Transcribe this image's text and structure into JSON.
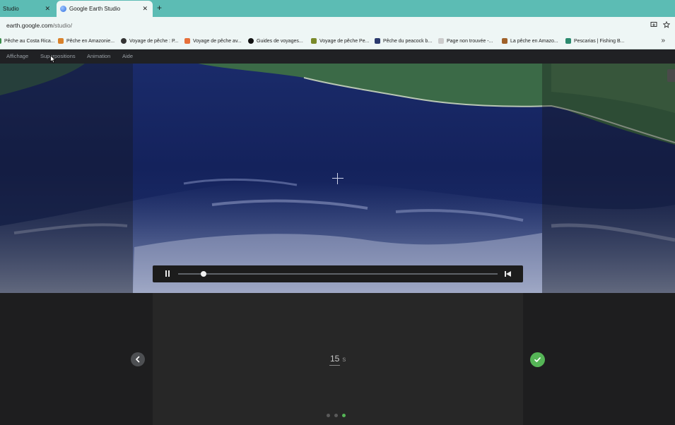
{
  "browser": {
    "tabs": [
      {
        "label": "Studio",
        "active": false
      },
      {
        "label": "Google Earth Studio",
        "active": true
      }
    ],
    "new_tab": "+",
    "close_glyph": "✕",
    "url_host": "earth.google.com",
    "url_path": "/studio/",
    "bookmarks": [
      {
        "label": "Pêche au Costa Rica...",
        "icon": "bookmark-icon",
        "color": "#3b8d4a"
      },
      {
        "label": "Pêche en Amazonie...",
        "icon": "bookmark-icon",
        "color": "#d9822b"
      },
      {
        "label": "Voyage de pêche : P...",
        "icon": "globe-icon",
        "color": "#333333"
      },
      {
        "label": "Voyage de pêche av...",
        "icon": "bookmark-icon",
        "color": "#e6703a"
      },
      {
        "label": "Guides de voyages...",
        "icon": "bookmark-icon",
        "color": "#111111"
      },
      {
        "label": "Voyage de pêche Pe...",
        "icon": "fish-icon",
        "color": "#7a8a2a"
      },
      {
        "label": "Pêche du peacock b...",
        "icon": "bookmark-icon",
        "color": "#2b3a6e"
      },
      {
        "label": "Page non trouvée -...",
        "icon": "page-icon",
        "color": "#bbbbbb"
      },
      {
        "label": "La pêche en Amazo...",
        "icon": "bookmark-icon",
        "color": "#a0622a"
      },
      {
        "label": "Pescarias | Fishing B...",
        "icon": "fish-icon",
        "color": "#2b8a6e"
      }
    ],
    "more_glyph": "»"
  },
  "menu": {
    "items": [
      "Affichage",
      "Superpositions",
      "Animation",
      "Aide"
    ]
  },
  "player": {
    "progress": 0.08,
    "pause_label": "pause",
    "restart_label": "restart"
  },
  "dialog": {
    "duration_value": "15",
    "duration_unit": "s",
    "steps_total": 3,
    "step_active": 3
  },
  "colors": {
    "tabbar": "#5cbcb4",
    "confirm": "#55b556",
    "water": "#152460"
  }
}
